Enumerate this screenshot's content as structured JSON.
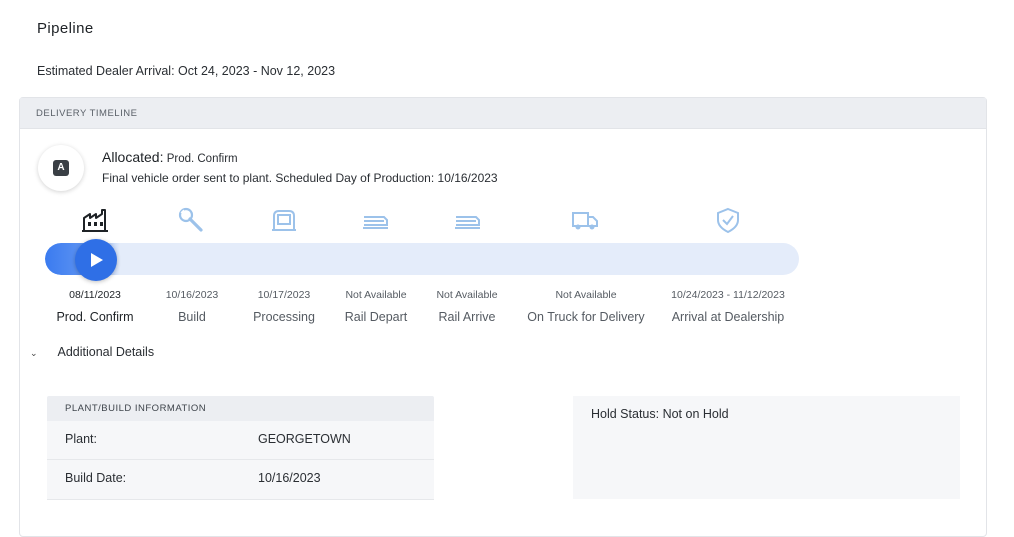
{
  "page": {
    "title": "Pipeline",
    "eta_label": "Estimated Dealer Arrival: Oct 24, 2023 - Nov 12, 2023"
  },
  "timeline": {
    "header": "DELIVERY TIMELINE",
    "status_badge": "A",
    "status_title": "Allocated:",
    "status_sub": "Prod. Confirm",
    "status_desc": "Final vehicle order sent to plant. Scheduled Day of Production: 10/16/2023",
    "progress_fraction": 0.1,
    "stages": [
      {
        "date": "08/11/2023",
        "name": "Prod. Confirm",
        "icon": "factory-icon",
        "active": true
      },
      {
        "date": "10/16/2023",
        "name": "Build",
        "icon": "wrench-icon",
        "active": false
      },
      {
        "date": "10/17/2023",
        "name": "Processing",
        "icon": "car-seat-icon",
        "active": false
      },
      {
        "date": "Not Available",
        "name": "Rail Depart",
        "icon": "rail-car-icon",
        "active": false
      },
      {
        "date": "Not Available",
        "name": "Rail Arrive",
        "icon": "rail-car-icon",
        "active": false
      },
      {
        "date": "Not Available",
        "name": "On Truck for Delivery",
        "icon": "truck-icon",
        "active": false
      },
      {
        "date": "10/24/2023 - 11/12/2023",
        "name": "Arrival at Dealership",
        "icon": "shield-check-icon",
        "active": false
      }
    ]
  },
  "details": {
    "toggle_label": "Additional Details",
    "plant_header": "PLANT/BUILD INFORMATION",
    "rows": [
      {
        "label": "Plant:",
        "value": "GEORGETOWN"
      },
      {
        "label": "Build Date:",
        "value": "10/16/2023"
      }
    ],
    "hold_status": "Hold Status: Not on Hold"
  },
  "colors": {
    "accent": "#2f6fe6",
    "track": "#e4ecfa",
    "inactive_icon": "#9cc2ea",
    "header_bg": "#eceef2"
  }
}
